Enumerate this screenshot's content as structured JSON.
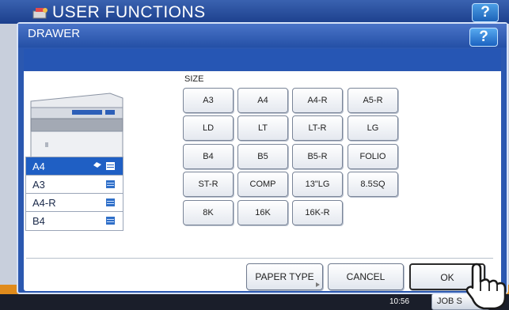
{
  "background": {
    "title": "USER FUNCTIONS",
    "help_label": "?",
    "time": "10:56",
    "jobs_label": "JOB S"
  },
  "dialog": {
    "title": "DRAWER",
    "help_label": "?"
  },
  "drawers": [
    {
      "label": "A4",
      "selected": true
    },
    {
      "label": "A3",
      "selected": false
    },
    {
      "label": "A4-R",
      "selected": false
    },
    {
      "label": "B4",
      "selected": false
    }
  ],
  "size": {
    "label": "SIZE",
    "rows": [
      [
        "A3",
        "A4",
        "A4-R",
        "A5-R"
      ],
      [
        "LD",
        "LT",
        "LT-R",
        "LG"
      ],
      [
        "B4",
        "B5",
        "B5-R",
        "FOLIO"
      ],
      [
        "ST-R",
        "COMP",
        "13\"LG",
        "8.5SQ"
      ],
      [
        "8K",
        "16K",
        "16K-R"
      ]
    ]
  },
  "actions": {
    "paper_type": "PAPER TYPE",
    "cancel": "CANCEL",
    "ok": "OK"
  },
  "colors": {
    "titlebar": "#2450a6",
    "selected_drawer": "#1f5fc4",
    "status_orange": "#e08b1c"
  }
}
